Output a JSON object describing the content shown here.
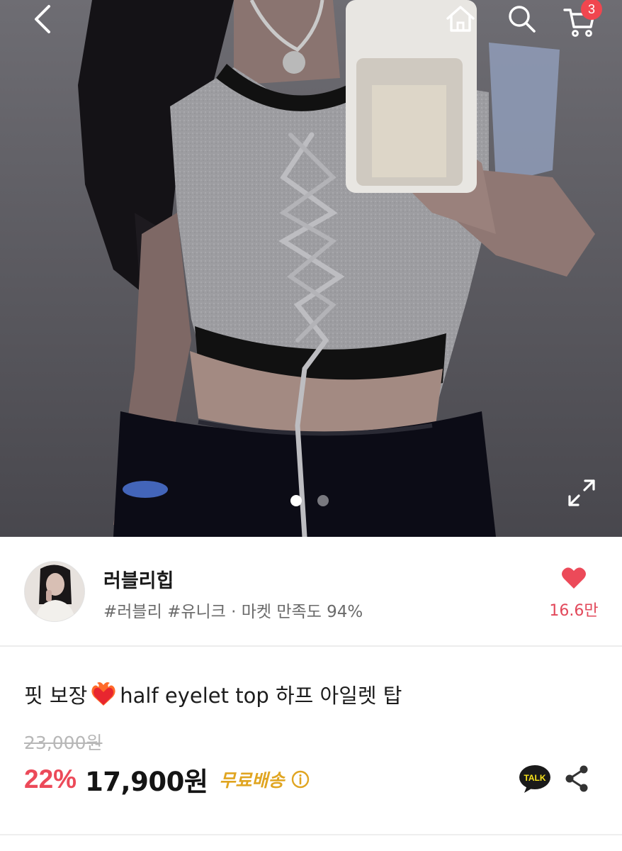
{
  "header": {
    "icons": [
      "chevron-left-icon",
      "home-icon",
      "search-icon",
      "cart-icon",
      "expand-icon"
    ],
    "cart_count": "3"
  },
  "carousel": {
    "total": 2,
    "active": 1
  },
  "seller": {
    "name": "러블리힙",
    "tags": "#러블리 #유니크 · 마켓 만족도 94%",
    "likes": "16.6만"
  },
  "product": {
    "title_before": "핏 보장",
    "title_after": "half eyelet top 하프 아일렛 탑",
    "original_price": "23,000원",
    "discount": "22%",
    "price": "17,900원",
    "shipping": "무료배송"
  },
  "actions": {
    "talk_label": "TALK"
  },
  "colors": {
    "accent_red": "#ec4a59",
    "shipping_gold": "#e0a521",
    "badge_red": "#f0464f",
    "talk_yellow": "#1a1a1a"
  }
}
